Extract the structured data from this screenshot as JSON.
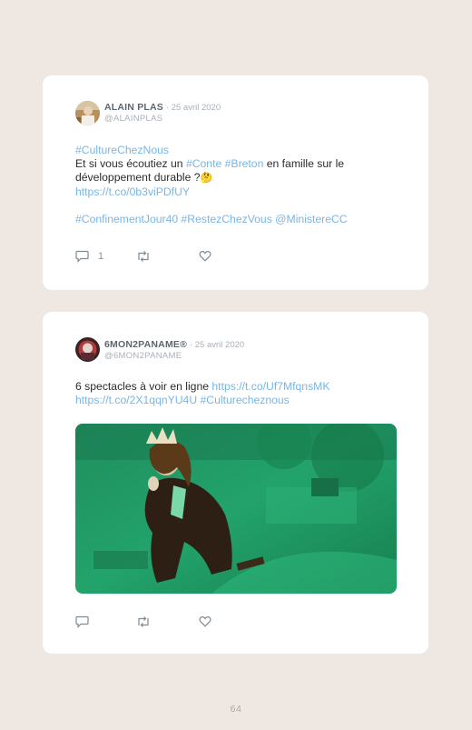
{
  "tweets": [
    {
      "author": "ALAIN PLAS",
      "date": "· 25 avril 2020",
      "handle": "@ALAINPLAS",
      "hashtag_top": "#CultureChezNous",
      "text_a": "Et si vous écoutiez un ",
      "tag_conte": "#Conte",
      "tag_breton": "#Breton",
      "text_b": " en famille sur le développement durable ?",
      "emoji": "🤔",
      "link": "https://t.co/0b3viPDfUY",
      "tags_bottom": "#ConfinementJour40 #RestezChezVous @MinistereCC",
      "reply_count": "1",
      "icons": [
        "reply-icon",
        "retweet-icon",
        "like-icon"
      ]
    },
    {
      "author": "6MON2PANAME®",
      "date": "· 25 avril 2020",
      "handle": "@6MON2PANAME",
      "text": "6 spectacles à voir en ligne ",
      "link1": "https://t.co/Uf7MfqnsMK",
      "link2": "https://t.co/2X1qqnYU4U",
      "tag": "#Culturecheznous",
      "icons": [
        "reply-icon",
        "retweet-icon",
        "like-icon"
      ]
    }
  ],
  "page_number": "64",
  "colors": {
    "background": "#efe7e2",
    "card": "#ffffff",
    "link": "#78b6e6",
    "media_green": "#1f9a66"
  }
}
